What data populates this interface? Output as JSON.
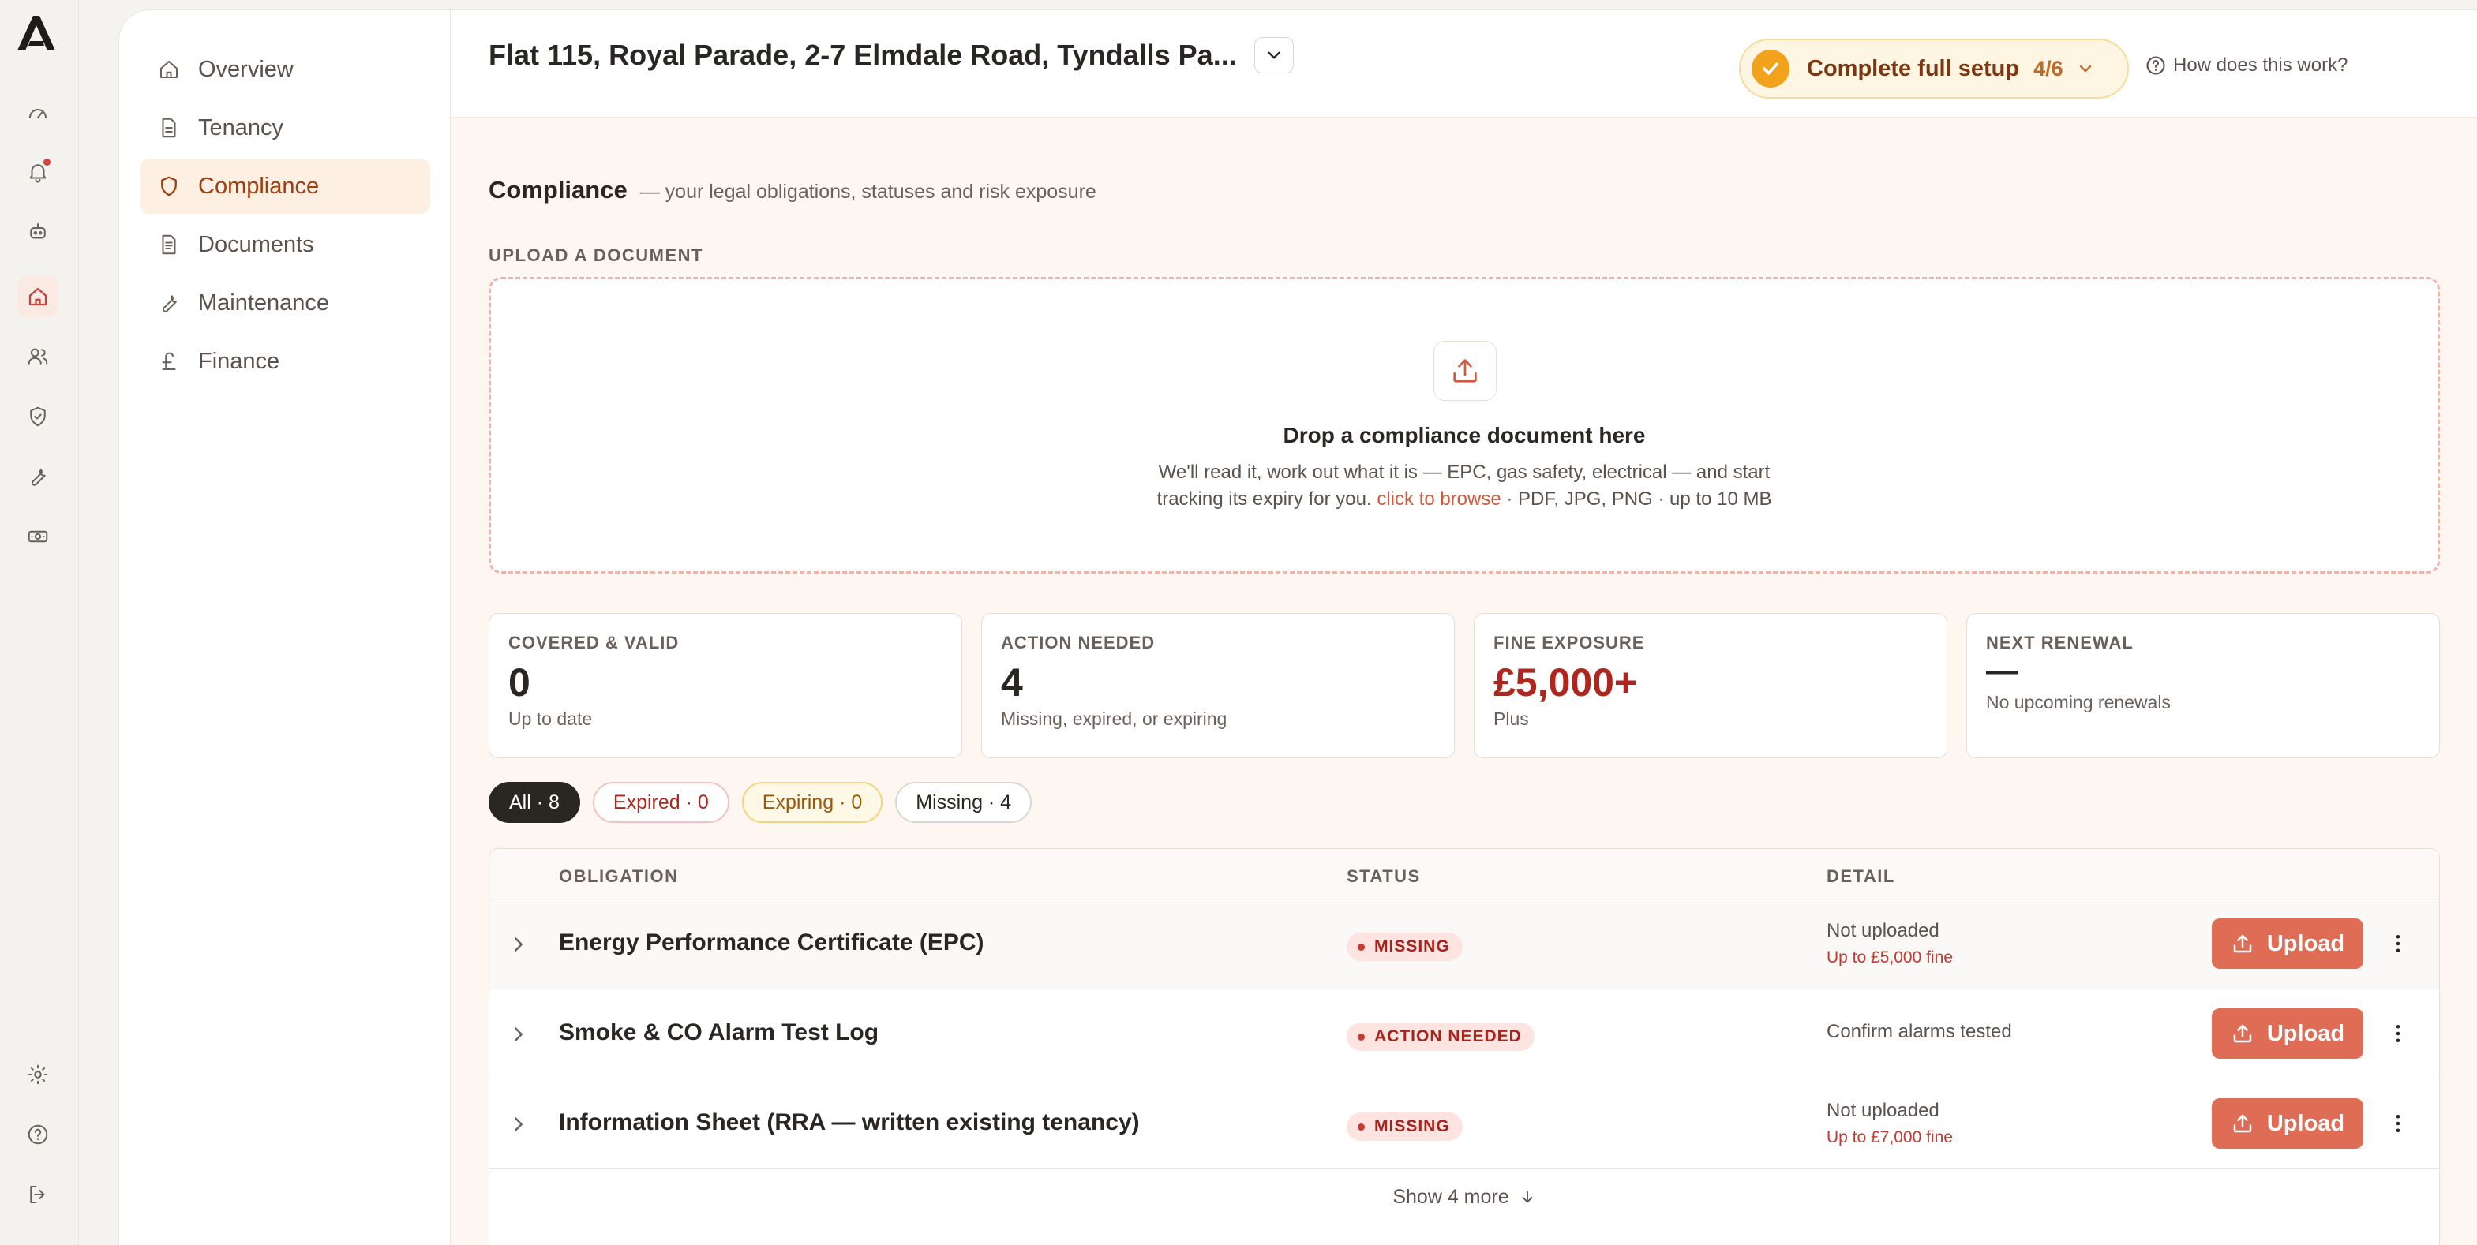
{
  "rail": {
    "logo_icon": "brand-a-logo",
    "items": [
      {
        "icon": "dashboard-gauge-icon",
        "active": false
      },
      {
        "icon": "bell-icon",
        "active": false,
        "has_notification": true
      },
      {
        "icon": "robot-assistant-icon",
        "active": false
      },
      {
        "icon": "home-icon",
        "active": true
      },
      {
        "icon": "users-icon",
        "active": false
      },
      {
        "icon": "shield-check-icon",
        "active": false
      },
      {
        "icon": "wrench-icon",
        "active": false
      },
      {
        "icon": "banknote-icon",
        "active": false
      }
    ],
    "bottom_items": [
      {
        "icon": "settings-gear-icon"
      },
      {
        "icon": "help-circle-icon"
      },
      {
        "icon": "logout-icon"
      }
    ]
  },
  "subnav": {
    "items": [
      {
        "label": "Overview",
        "icon": "home-icon",
        "active": false
      },
      {
        "label": "Tenancy",
        "icon": "file-icon",
        "active": false
      },
      {
        "label": "Compliance",
        "icon": "shield-icon",
        "active": true
      },
      {
        "label": "Documents",
        "icon": "document-icon",
        "active": false
      },
      {
        "label": "Maintenance",
        "icon": "wrench-icon",
        "active": false
      },
      {
        "label": "Finance",
        "icon": "pound-icon",
        "active": false
      }
    ]
  },
  "topbar": {
    "property_title": "Flat 115, Royal Parade, 2-7 Elmdale Road, Tyndalls Pa...",
    "setup": {
      "label": "Complete full setup",
      "count": "4/6"
    },
    "help_link": "How does this work?"
  },
  "section": {
    "title": "Compliance",
    "subtitle": "— your legal obligations, statuses and risk exposure"
  },
  "upload": {
    "label": "UPLOAD A DOCUMENT",
    "title": "Drop a compliance document here",
    "text_line1": "We'll read it, work out what it is — EPC, gas safety, electrical — and start",
    "text_line2_prefix": "tracking its expiry for you.",
    "browse_link": "click to browse",
    "text_line2_suffix": "· PDF, JPG, PNG · up to 10 MB"
  },
  "stats": [
    {
      "label": "COVERED & VALID",
      "value": "0",
      "sub": "Up to date"
    },
    {
      "label": "ACTION NEEDED",
      "value": "4",
      "sub": "Missing, expired, or expiring"
    },
    {
      "label": "FINE EXPOSURE",
      "value": "£5,000+",
      "sub": "Plus"
    },
    {
      "label": "NEXT RENEWAL",
      "value": "—",
      "sub": "No upcoming renewals"
    }
  ],
  "filters": [
    {
      "label": "All · 8",
      "style": "all"
    },
    {
      "label": "Expired · 0",
      "style": "expired"
    },
    {
      "label": "Expiring · 0",
      "style": "expiring"
    },
    {
      "label": "Missing · 4",
      "style": "missing"
    }
  ],
  "table": {
    "headers": {
      "obligation": "OBLIGATION",
      "status": "STATUS",
      "detail": "DETAIL"
    },
    "rows": [
      {
        "name": "Energy Performance Certificate (EPC)",
        "status": "MISSING",
        "detail": "Not uploaded",
        "fine": "Up to £5,000 fine",
        "action": "Upload"
      },
      {
        "name": "Smoke & CO Alarm Test Log",
        "status": "ACTION NEEDED",
        "detail": "Confirm alarms tested",
        "fine": "",
        "action": "Upload"
      },
      {
        "name": "Information Sheet (RRA — written existing tenancy)",
        "status": "MISSING",
        "detail": "Not uploaded",
        "fine": "Up to £7,000 fine",
        "action": "Upload"
      }
    ],
    "show_more": "Show 4 more"
  },
  "colors": {
    "accent": "#df6c55",
    "danger": "#b0251c",
    "warning": "#f2a21b",
    "active_nav_bg": "#fdf0e2"
  }
}
